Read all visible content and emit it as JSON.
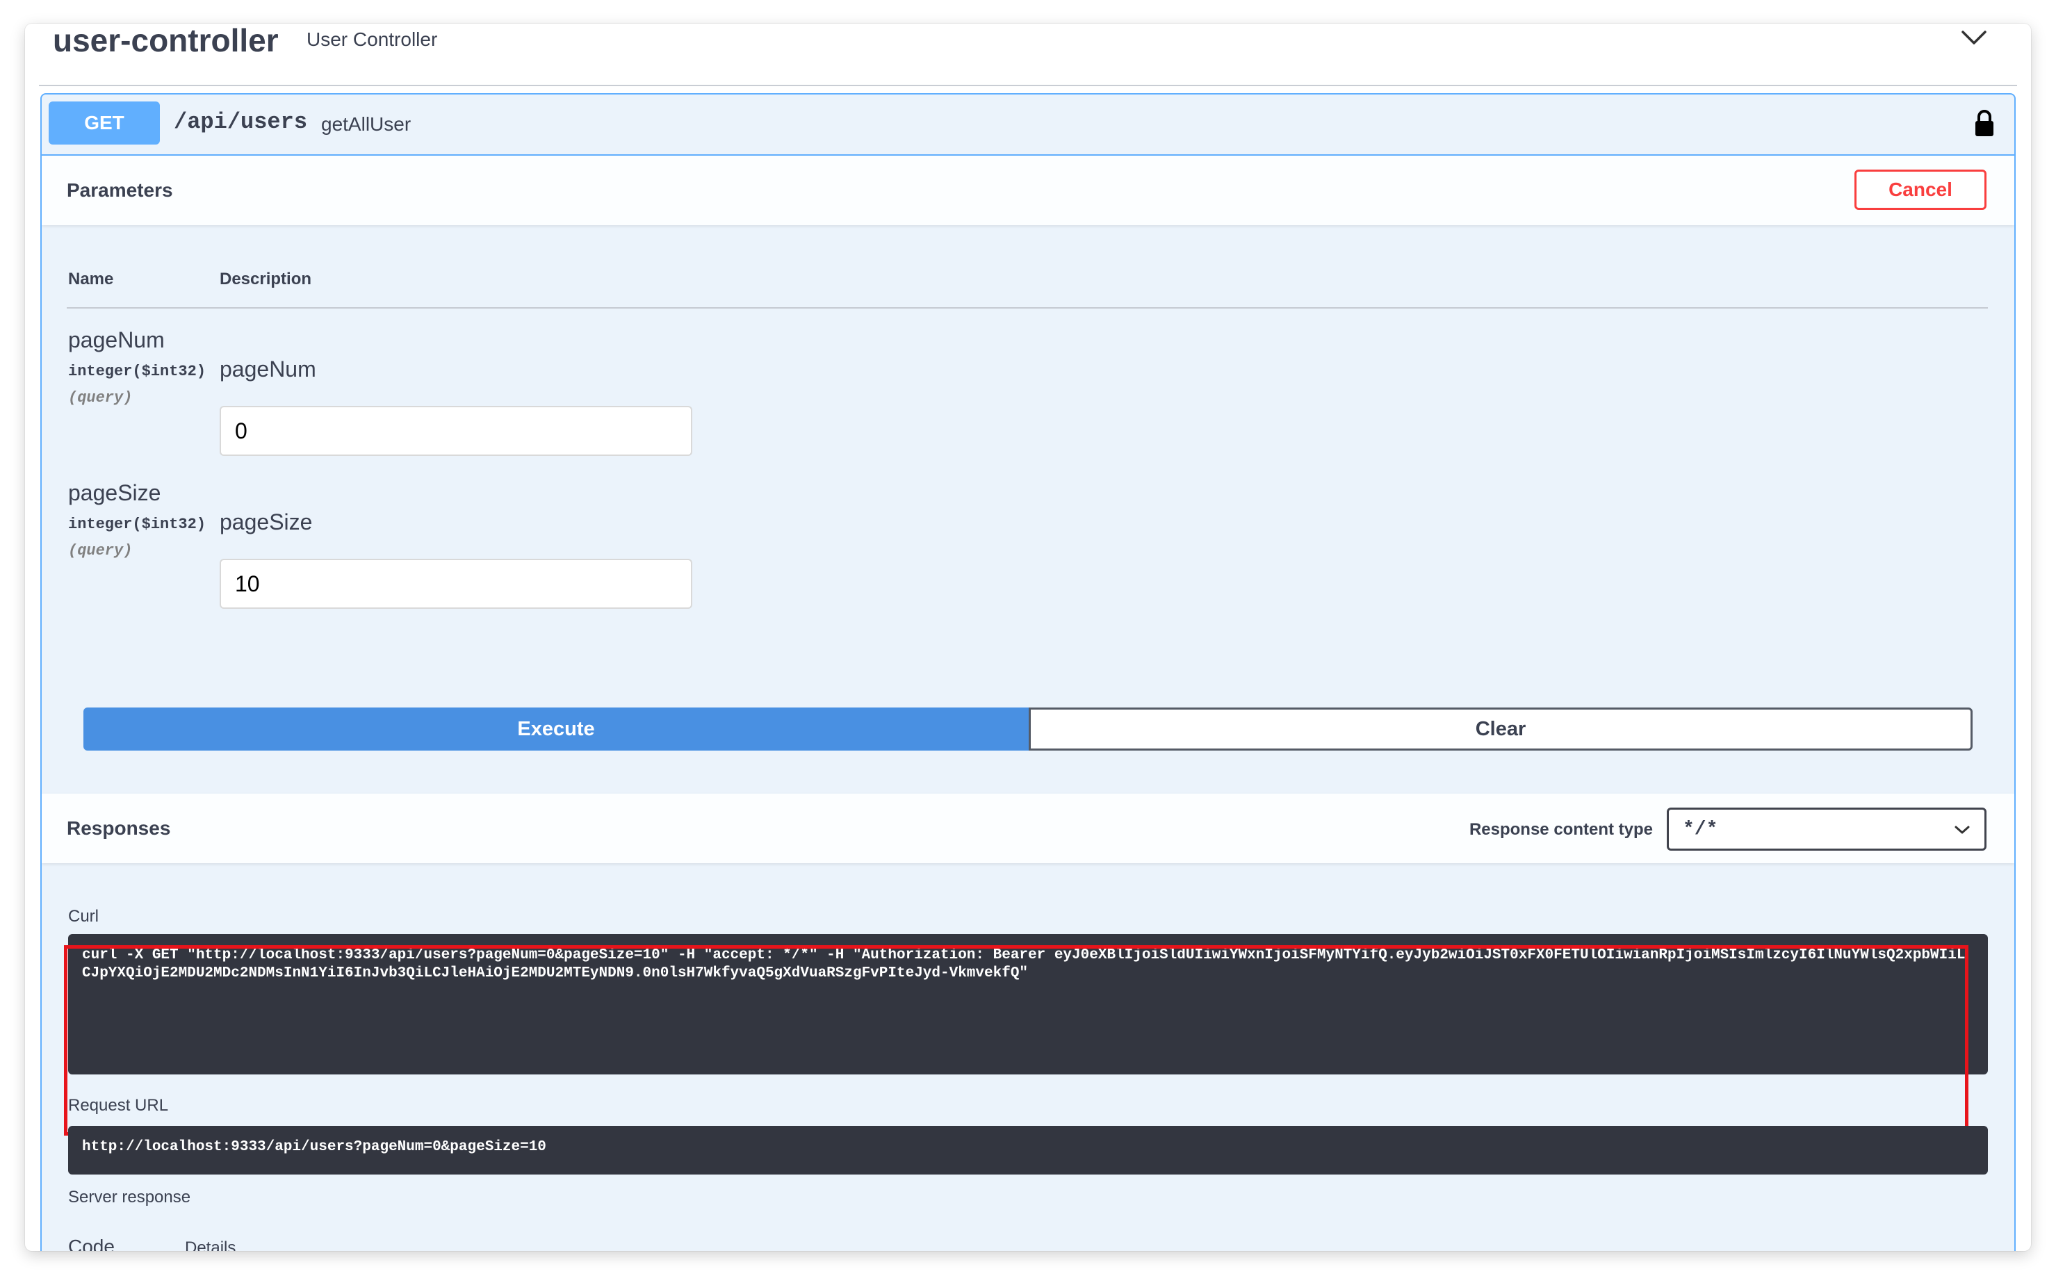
{
  "tag": {
    "name": "user-controller",
    "description": "User Controller"
  },
  "operation": {
    "method": "GET",
    "path": "/api/users",
    "operation_id": "getAllUser"
  },
  "parameters": {
    "title": "Parameters",
    "cancel_label": "Cancel",
    "col_name": "Name",
    "col_description": "Description",
    "items": [
      {
        "name": "pageNum",
        "type": "integer($int32)",
        "in": "(query)",
        "description": "pageNum",
        "value": "0"
      },
      {
        "name": "pageSize",
        "type": "integer($int32)",
        "in": "(query)",
        "description": "pageSize",
        "value": "10"
      }
    ]
  },
  "actions": {
    "execute_label": "Execute",
    "clear_label": "Clear"
  },
  "responses": {
    "title": "Responses",
    "content_type_label": "Response content type",
    "content_type_value": "*/*",
    "curl_label": "Curl",
    "curl_command": "curl -X GET \"http://localhost:9333/api/users?pageNum=0&pageSize=10\" -H \"accept: */*\" -H \"Authorization: Bearer eyJ0eXBlIjoiSldUIiwiYWxnIjoiSFMyNTYifQ.eyJyb2wiOiJST0xFX0FETUlOIiwianRpIjoiMSIsImlzcyI6IlNuYWlsQ2xpbWIiLCJpYXQiOjE2MDU2MDc2NDMsInN1YiI6InJvb3QiLCJleHAiOjE2MDU2MTEyNDN9.0n0lsH7WkfyvaQ5gXdVuaRSzgFvPIteJyd-VkmvekfQ\"",
    "request_url_label": "Request URL",
    "request_url": "http://localhost:9333/api/users?pageNum=0&pageSize=10",
    "server_response_label": "Server response",
    "col_code": "Code",
    "col_details": "Details"
  },
  "colors": {
    "get_accent": "#61affe",
    "execute": "#4990e2",
    "cancel": "#f93e3e",
    "highlight": "#e8141b",
    "code_bg": "#333640"
  },
  "icons": [
    "chevron-down-icon",
    "lock-icon"
  ]
}
